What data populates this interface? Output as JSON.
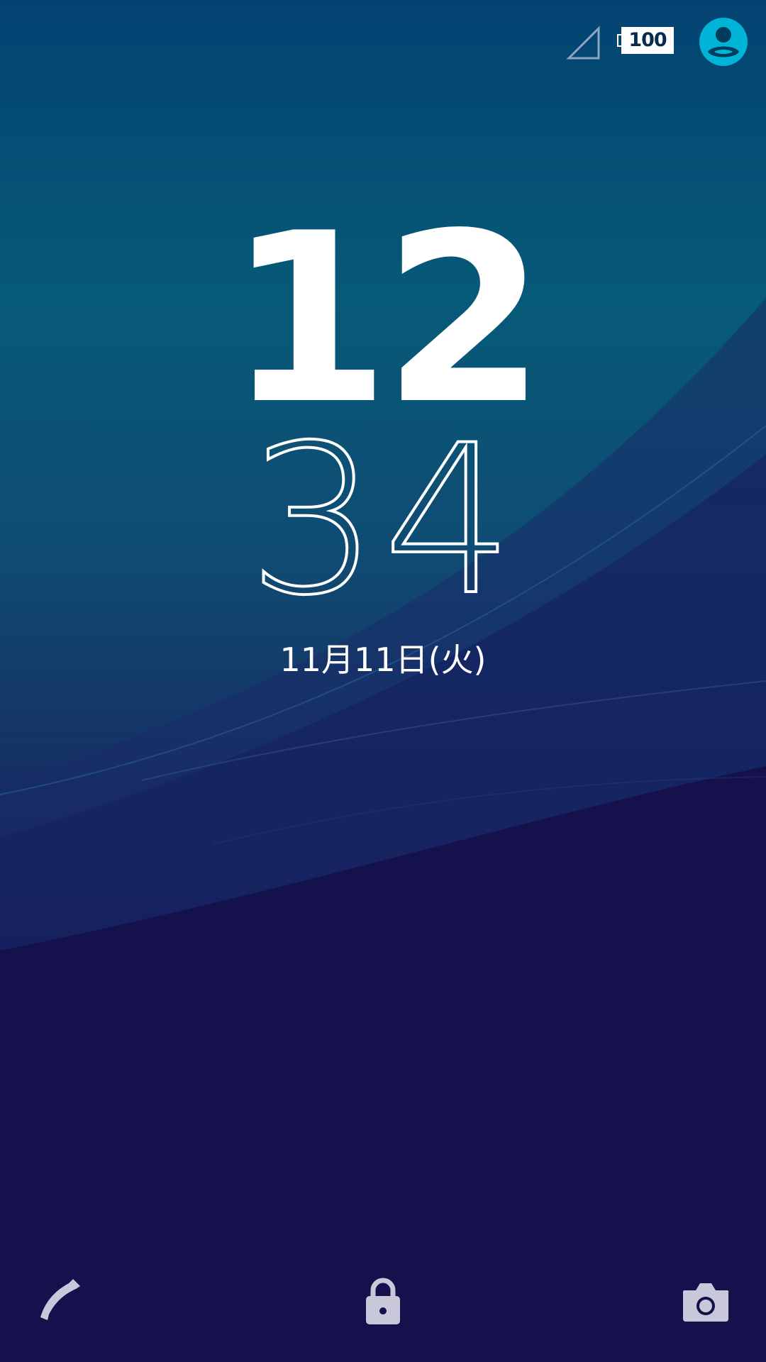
{
  "status_bar": {
    "signal_icon": "signal-empty-icon",
    "battery_level": "100",
    "avatar_icon": "user-avatar-icon",
    "avatar_color": "#00b4d8"
  },
  "clock": {
    "hours": "12",
    "minutes": "34",
    "date": "11月11日(火)"
  },
  "shortcuts": {
    "phone_icon": "phone-icon",
    "lock_icon": "lock-icon",
    "camera_icon": "camera-icon",
    "icon_color": "#c8c8da"
  },
  "colors": {
    "background_top": "#034372",
    "background_bottom": "#150f4a",
    "text": "#ffffff"
  }
}
